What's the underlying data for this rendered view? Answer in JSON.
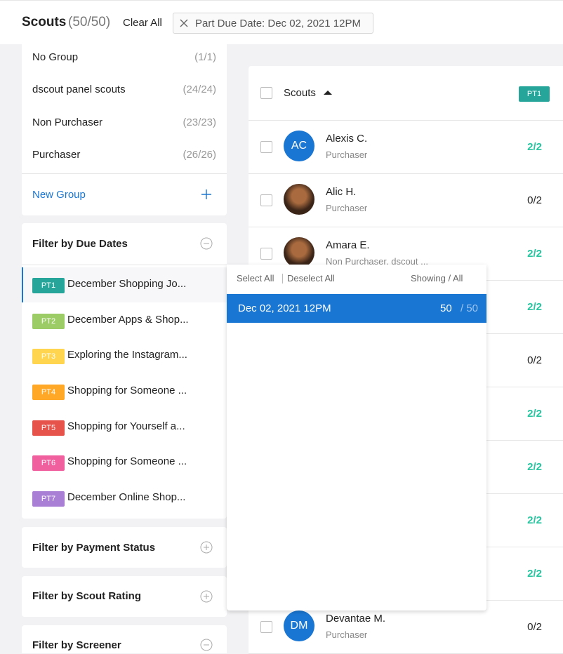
{
  "header": {
    "title": "Scouts",
    "count": "(50/50)",
    "clear_all": "Clear All",
    "chip_label": "Part Due Date: Dec 02, 2021 12PM"
  },
  "groups": {
    "items": [
      {
        "name": "No Group",
        "count": "(1/1)"
      },
      {
        "name": "dscout panel scouts",
        "count": "(24/24)"
      },
      {
        "name": "Non Purchaser",
        "count": "(23/23)"
      },
      {
        "name": "Purchaser",
        "count": "(26/26)"
      }
    ],
    "new_group": "New Group"
  },
  "due_dates": {
    "title": "Filter by Due Dates",
    "parts": [
      {
        "badge": "PT1",
        "name": "December Shopping Jo...",
        "color": "#26a69a"
      },
      {
        "badge": "PT2",
        "name": "December Apps & Shop...",
        "color": "#9ccc65"
      },
      {
        "badge": "PT3",
        "name": "Exploring the Instagram...",
        "color": "#ffd54f"
      },
      {
        "badge": "PT4",
        "name": "Shopping for Someone ...",
        "color": "#ffa726"
      },
      {
        "badge": "PT5",
        "name": "Shopping for Yourself a...",
        "color": "#e5534b"
      },
      {
        "badge": "PT6",
        "name": "Shopping for Someone ...",
        "color": "#f0609e"
      },
      {
        "badge": "PT7",
        "name": "December Online Shop...",
        "color": "#a97fd6"
      }
    ]
  },
  "filters": {
    "payment": "Filter by Payment Status",
    "rating": "Filter by Scout Rating",
    "screener": "Filter by Screener"
  },
  "table": {
    "header": "Scouts",
    "part_badge": "PT1",
    "rows": [
      {
        "initials": "AC",
        "name": "Alexis C.",
        "group": "Purchaser",
        "value": "2/2",
        "complete": true
      },
      {
        "initials": "",
        "name": "Alic H.",
        "group": "Purchaser",
        "value": "0/2",
        "complete": false
      },
      {
        "initials": "",
        "name": "Amara E.",
        "group": "Non Purchaser, dscout ...",
        "value": "2/2",
        "complete": true
      },
      {
        "initials": "",
        "name": "",
        "group": "",
        "value": "2/2",
        "complete": true
      },
      {
        "initials": "",
        "name": "",
        "group": "",
        "value": "0/2",
        "complete": false
      },
      {
        "initials": "",
        "name": "",
        "group": "",
        "value": "2/2",
        "complete": true
      },
      {
        "initials": "",
        "name": "",
        "group": "",
        "value": "2/2",
        "complete": true
      },
      {
        "initials": "",
        "name": "",
        "group": "",
        "value": "2/2",
        "complete": true
      },
      {
        "initials": "",
        "name": "",
        "group": "",
        "value": "2/2",
        "complete": true
      },
      {
        "initials": "DM",
        "name": "Devantae M.",
        "group": "Purchaser",
        "value": "0/2",
        "complete": false
      }
    ]
  },
  "dropdown": {
    "select_all": "Select All",
    "deselect_all": "Deselect All",
    "showing_all": "Showing / All",
    "option_date": "Dec 02, 2021 12PM",
    "option_showing": "50",
    "option_total": "/ 50"
  },
  "colors": {
    "accent": "#1976d2",
    "complete": "#26c6a0",
    "incomplete": "#222222"
  }
}
